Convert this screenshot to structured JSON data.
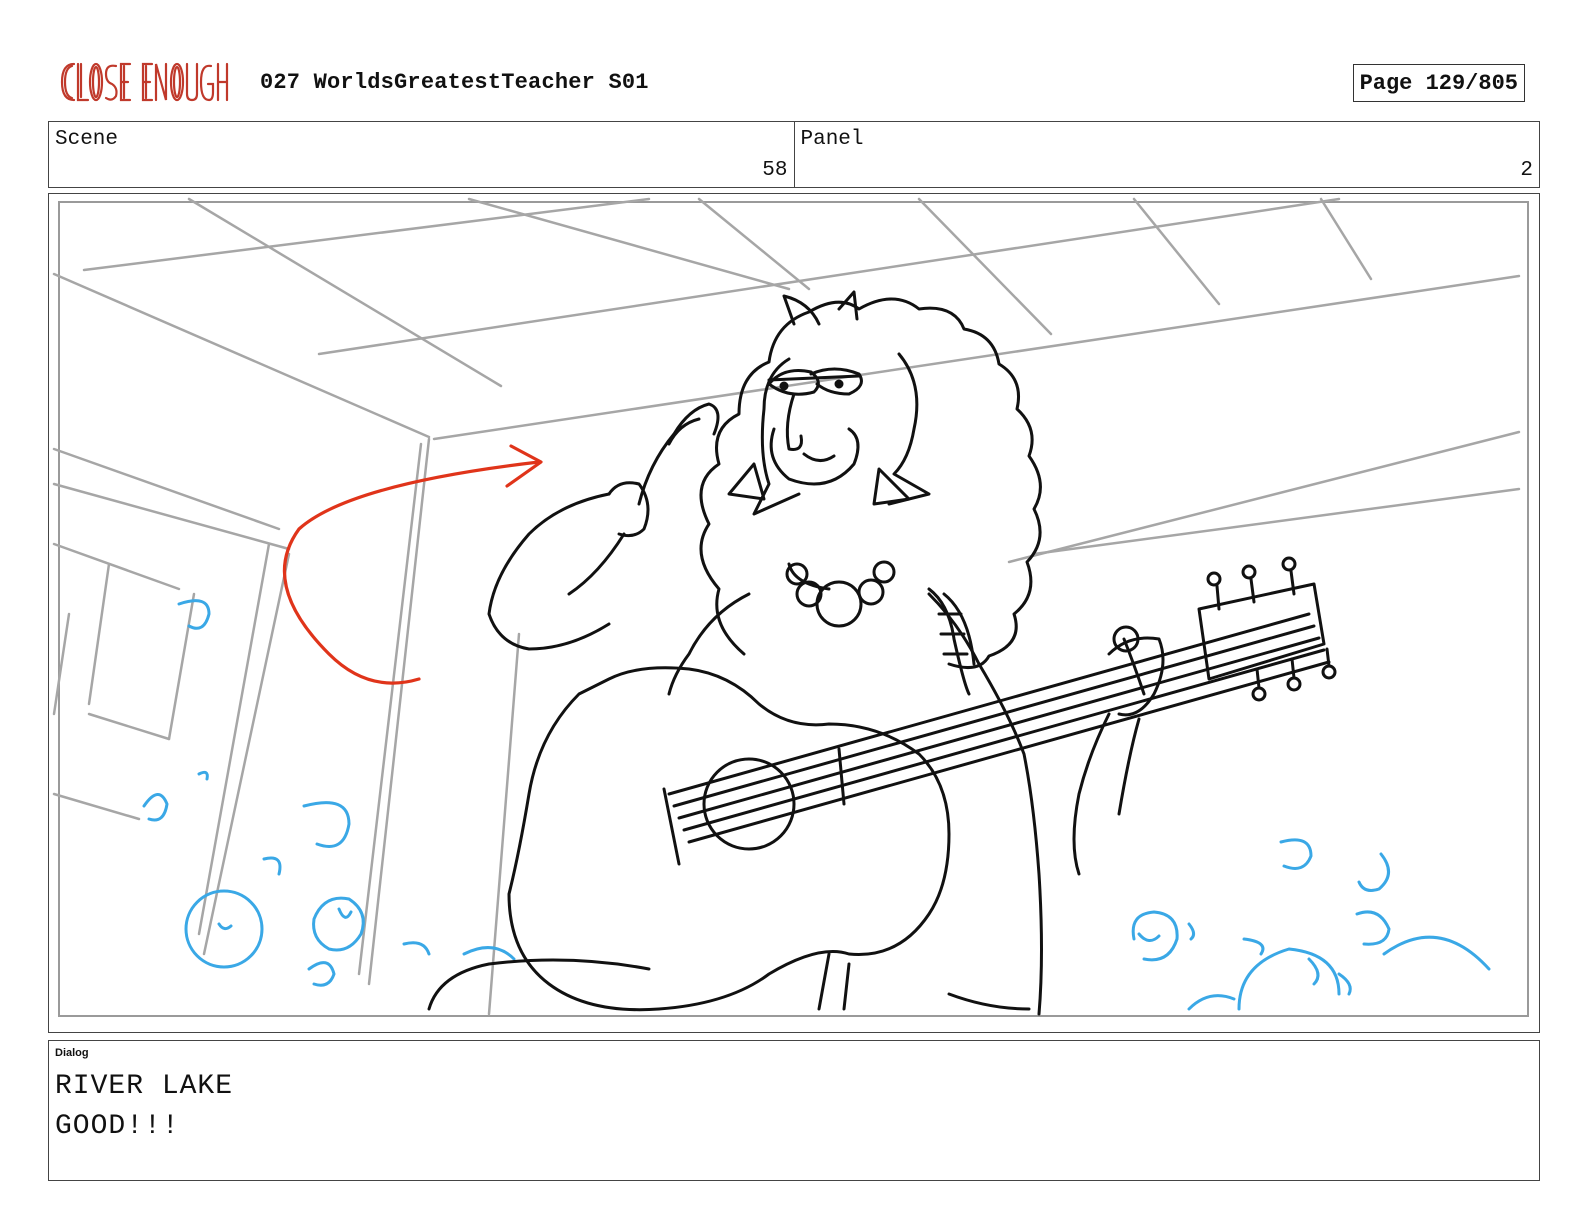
{
  "header": {
    "logo_text": "CLOSE ENOUGH",
    "title": "027 WorldsGreatestTeacher S01",
    "page_label": "Page 129/805"
  },
  "info": {
    "scene_label": "Scene",
    "scene_value": "58",
    "panel_label": "Panel",
    "panel_value": "2"
  },
  "dialog": {
    "label": "Dialog",
    "lines": [
      "RIVER LAKE",
      "GOOD!!!"
    ]
  },
  "colors": {
    "logo": "#c0392b",
    "arrow": "#e0341a",
    "crowd": "#3aa8e6",
    "ceiling": "#9a9a9a",
    "ink": "#111111"
  }
}
